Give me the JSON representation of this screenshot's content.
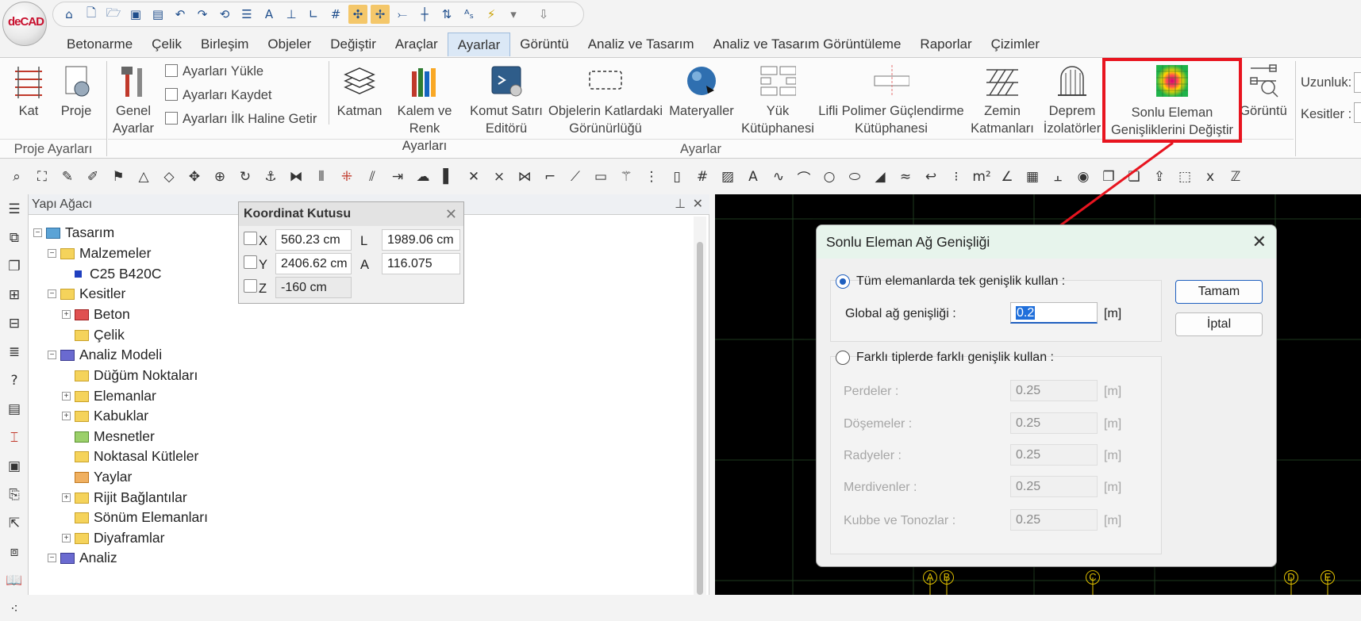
{
  "logo": {
    "text": "deCAD"
  },
  "menu": [
    "Betonarme",
    "Çelik",
    "Birleşim",
    "Objeler",
    "Değiştir",
    "Araçlar",
    "Ayarlar",
    "Görüntü",
    "Analiz ve Tasarım",
    "Analiz ve Tasarım Görüntüleme",
    "Raporlar",
    "Çizimler"
  ],
  "active_menu": "Ayarlar",
  "ribbon": {
    "kat": "Kat",
    "proje": "Proje",
    "group_proje": "Proje Ayarları",
    "genel": "Genel",
    "ayarlar": "Ayarlar",
    "yukle": "Ayarları Yükle",
    "kaydet": "Ayarları Kaydet",
    "ilk": "Ayarları İlk Haline Getir",
    "katman": "Katman",
    "kalem1": "Kalem ve",
    "kalem2": "Renk Ayarları",
    "komut1": "Komut Satırı",
    "komut2": "Editörü",
    "obj1": "Objelerin Katlardaki",
    "obj2": "Görünürlüğü",
    "materyal": "Materyaller",
    "yuk1": "Yük",
    "yuk2": "Kütüphanesi",
    "lifli1": "Lifli Polimer Güçlendirme",
    "lifli2": "Kütüphanesi",
    "zemin1": "Zemin",
    "zemin2": "Katmanları",
    "deprem1": "Deprem",
    "deprem2": "İzolatörler",
    "sonlu1": "Sonlu Eleman",
    "sonlu2": "Genişliklerini Değiştir",
    "goruntu": "Görüntü",
    "group_ayarlar": "Ayarlar",
    "uzunluk": "Uzunluk:",
    "kesitler": "Kesitler"
  },
  "tree": {
    "header": "Yapı Ağacı",
    "items": [
      "Tasarım",
      "Malzemeler",
      "C25 B420C",
      "Kesitler",
      "Beton",
      "Çelik",
      "Analiz Modeli",
      "Düğüm Noktaları",
      "Elemanlar",
      "Kabuklar",
      "Mesnetler",
      "Noktasal Kütleler",
      "Yaylar",
      "Rijit Bağlantılar",
      "Sönüm Elemanları",
      "Diyaframlar",
      "Analiz"
    ]
  },
  "coord": {
    "title": "Koordinat Kutusu",
    "x_label": "X",
    "x": "560.23 cm",
    "y_label": "Y",
    "y": "2406.62 cm",
    "z_label": "Z",
    "z": "-160 cm",
    "l_label": "L",
    "l": "1989.06 cm",
    "a_label": "A",
    "a": "116.075"
  },
  "axes": [
    "A",
    "B",
    "C",
    "D",
    "E"
  ],
  "dialog": {
    "title": "Sonlu Eleman Ağ Genişliği",
    "opt1": "Tüm elemanlarda tek genişlik kullan :",
    "global_label": "Global ağ genişliği :",
    "global_value": "0.2",
    "unit": "[m]",
    "opt2": "Farklı tiplerde farklı genişlik kullan :",
    "rows": [
      {
        "label": "Perdeler :",
        "value": "0.25"
      },
      {
        "label": "Döşemeler :",
        "value": "0.25"
      },
      {
        "label": "Radyeler :",
        "value": "0.25"
      },
      {
        "label": "Merdivenler :",
        "value": "0.25"
      },
      {
        "label": "Kubbe ve Tonozlar :",
        "value": "0.25"
      }
    ],
    "ok": "Tamam",
    "cancel": "İptal"
  },
  "colors": {
    "highlight": "#e8141f",
    "accent": "#1f5fbf",
    "canvas": "#000000",
    "axis": "#e5c400"
  }
}
